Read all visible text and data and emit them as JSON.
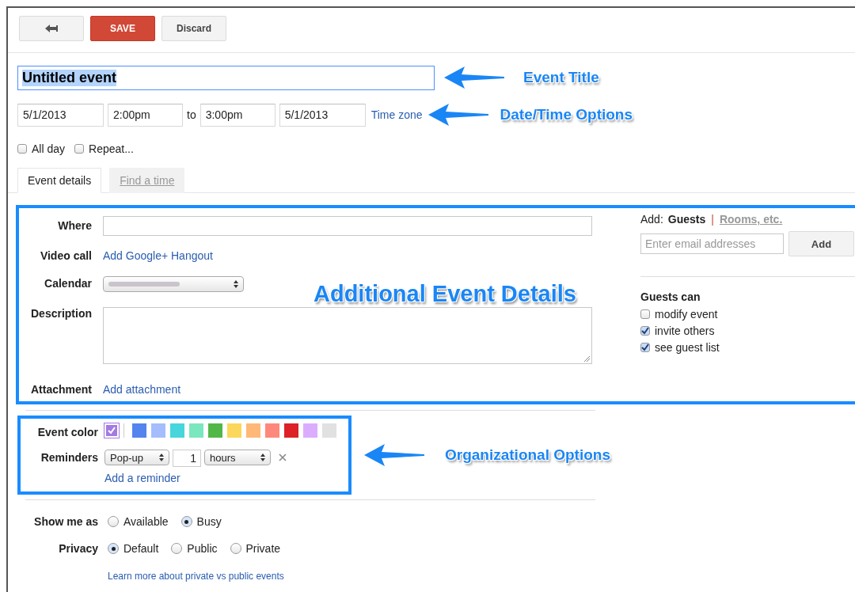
{
  "toolbar": {
    "buttons": [
      {
        "kind": "back"
      },
      {
        "kind": "primary",
        "label": "SAVE"
      },
      {
        "kind": "secondary",
        "label": "Discard"
      }
    ]
  },
  "title": {
    "value": "Untitled event",
    "selected": true
  },
  "datetime": {
    "start_date": "5/1/2013",
    "start_time": "2:00pm",
    "to": "to",
    "end_time": "3:00pm",
    "end_date": "5/1/2013",
    "timezone_link": "Time zone"
  },
  "options": [
    {
      "label": "All day",
      "checked": false
    },
    {
      "label": "Repeat...",
      "checked": false
    }
  ],
  "tabs": [
    {
      "label": "Event details",
      "selected": true
    },
    {
      "label": "Find a time",
      "selected": false
    }
  ],
  "details": {
    "fields": [
      {
        "kind": "input",
        "label": "Where"
      },
      {
        "kind": "link",
        "label": "Video call",
        "link": "Add Google+ Hangout"
      },
      {
        "kind": "select",
        "label": "Calendar"
      },
      {
        "kind": "textarea",
        "label": "Description"
      },
      {
        "kind": "link",
        "label": "Attachment",
        "link": "Add attachment"
      }
    ]
  },
  "guests": {
    "add_label": "Add:",
    "separator": "|",
    "tabs": [
      {
        "label": "Guests",
        "selected": true
      },
      {
        "label": "Rooms, etc.",
        "selected": false
      }
    ],
    "email": {
      "placeholder": "Enter email addresses"
    },
    "add_button": "Add",
    "permissions_title": "Guests can",
    "permissions": [
      {
        "label": "modify event",
        "checked": false
      },
      {
        "label": "invite others",
        "checked": true
      },
      {
        "label": "see guest list",
        "checked": true
      }
    ]
  },
  "organization": {
    "color_label": "Event color",
    "colors": [
      {
        "color": "#a47ae2",
        "selected": true
      },
      {
        "color": "#5484ed",
        "selected": false
      },
      {
        "color": "#a4bdfc",
        "selected": false
      },
      {
        "color": "#46d6db",
        "selected": false
      },
      {
        "color": "#7ae7bf",
        "selected": false
      },
      {
        "color": "#51b749",
        "selected": false
      },
      {
        "color": "#fbd75b",
        "selected": false
      },
      {
        "color": "#ffb878",
        "selected": false
      },
      {
        "color": "#ff887c",
        "selected": false
      },
      {
        "color": "#dc2127",
        "selected": false
      },
      {
        "color": "#dbadff",
        "selected": false
      },
      {
        "color": "#e1e1e1",
        "selected": false
      }
    ],
    "reminders_label": "Reminders",
    "reminder": {
      "method": "Pop-up",
      "amount": "1",
      "unit": "hours"
    },
    "add_reminder": "Add a reminder"
  },
  "show_me_as": {
    "label": "Show me as",
    "options": [
      {
        "label": "Available",
        "selected": false
      },
      {
        "label": "Busy",
        "selected": true
      }
    ]
  },
  "privacy": {
    "label": "Privacy",
    "options": [
      {
        "label": "Default",
        "selected": true
      },
      {
        "label": "Public",
        "selected": false
      },
      {
        "label": "Private",
        "selected": false
      }
    ],
    "learn_more": "Learn more about private vs public events"
  },
  "annotations": [
    {
      "text": "Event Title"
    },
    {
      "text": "Date/Time Options"
    },
    {
      "text": "Additional Event Details"
    },
    {
      "text": "Organizational Options"
    }
  ]
}
